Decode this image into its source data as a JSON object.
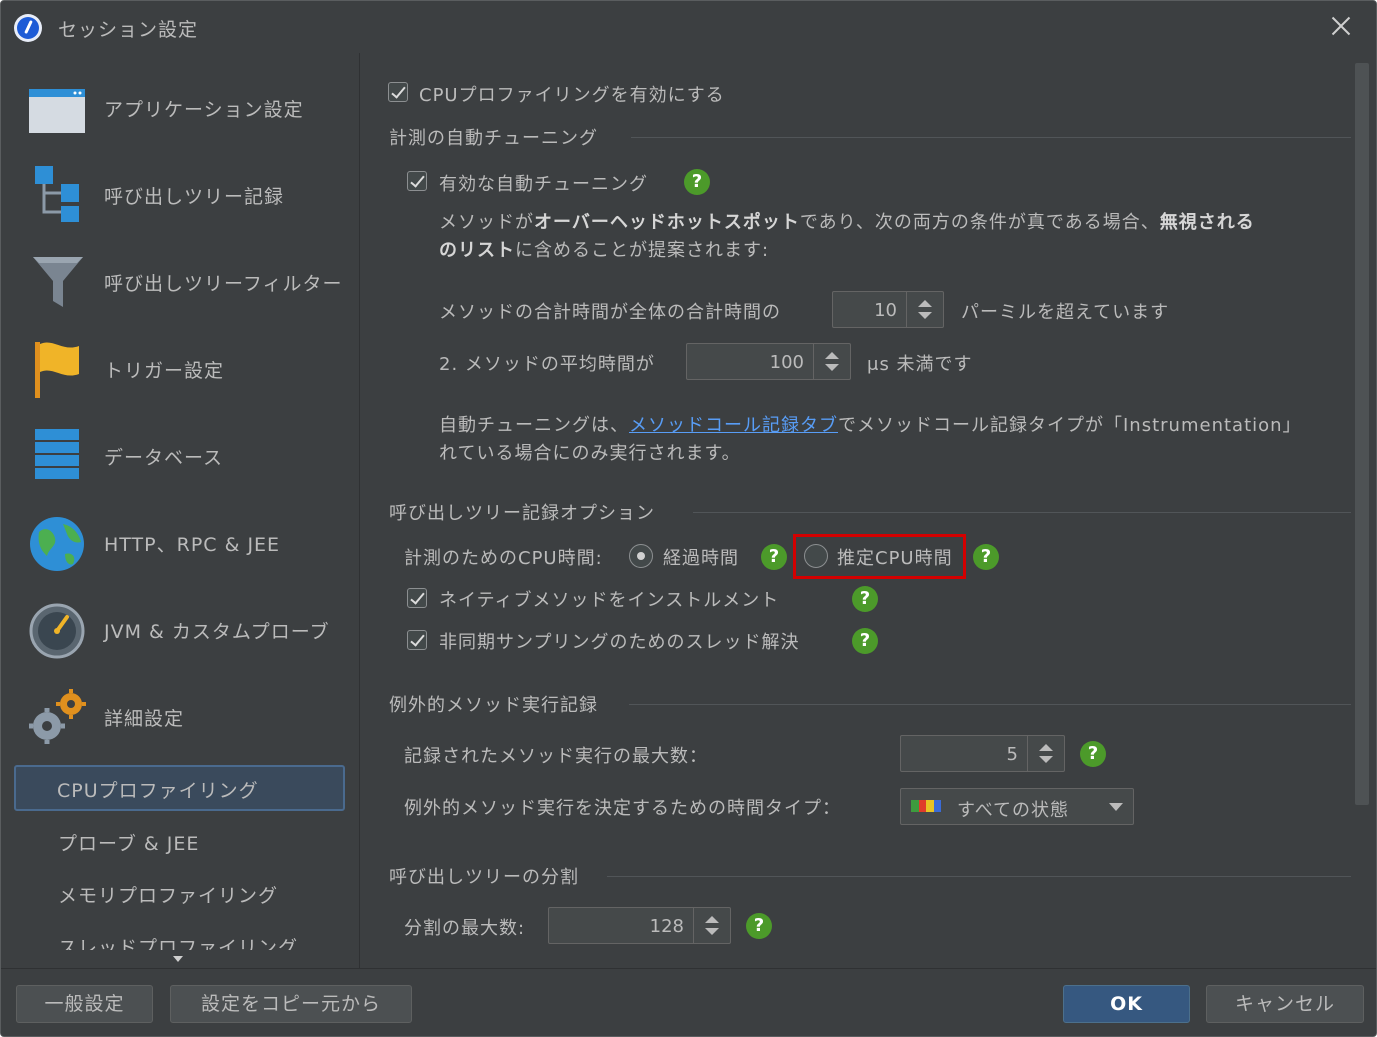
{
  "window": {
    "title": "セッション設定"
  },
  "sidebar": {
    "items": [
      {
        "label": "アプリケーション設定",
        "icon": "application-window-icon"
      },
      {
        "label": "呼び出しツリー記録",
        "icon": "call-tree-icon"
      },
      {
        "label": "呼び出しツリーフィルター",
        "icon": "filter-funnel-icon"
      },
      {
        "label": "トリガー設定",
        "icon": "flag-icon"
      },
      {
        "label": "データベース",
        "icon": "database-icon"
      },
      {
        "label": "HTTP、RPC & JEE",
        "icon": "globe-icon"
      },
      {
        "label": "JVM & カスタムプローブ",
        "icon": "gauge-icon"
      },
      {
        "label": "詳細設定",
        "icon": "gears-icon"
      }
    ],
    "sub_items": [
      {
        "label": "CPUプロファイリング",
        "selected": true
      },
      {
        "label": "プローブ & JEE"
      },
      {
        "label": "メモリプロファイリング"
      },
      {
        "label": "スレッドプロファイリング"
      }
    ]
  },
  "content": {
    "enable_cpu": "CPUプロファイリングを有効にする",
    "auto_tuning": {
      "section_title": "計測の自動チューニング",
      "enabled_label": "有効な自動チューニング",
      "desc_1": "メソッドが",
      "desc_bold_1": "オーバーヘッドホットスポット",
      "desc_2": "であり、次の両方の条件が真である場合、",
      "desc_bold_2": "無視される",
      "desc_bold_3": "のリスト",
      "desc_3": "に含めることが提案されます:",
      "cond1_prefix": "メソッドの合計時間が全体の合計時間の",
      "cond1_value": "10",
      "cond1_suffix": "パーミルを超えています",
      "cond2_prefix": "2. メソッドの平均時間が",
      "cond2_value": "100",
      "cond2_suffix": "μs 未満です",
      "note_1": "自動チューニングは、",
      "note_link": "メソッドコール記録タブ",
      "note_2": "でメソッドコール記録タイプが「Instrumentation」",
      "note_3": "れている場合にのみ実行されます。"
    },
    "call_tree_options": {
      "section_title": "呼び出しツリー記録オプション",
      "cpu_time_label": "計測のためのCPU時間:",
      "radio_elapsed": "経過時間",
      "radio_estimated": "推定CPU時間",
      "native_methods": "ネイティブメソッドをインストルメント",
      "async_sampling": "非同期サンプリングのためのスレッド解決"
    },
    "exceptional": {
      "section_title": "例外的メソッド実行記録",
      "max_label": "記録されたメソッド実行の最大数：",
      "max_value": "5",
      "time_type_label": "例外的メソッド実行を決定するための時間タイプ：",
      "time_type_value": "すべての状態"
    },
    "split": {
      "section_title": "呼び出しツリーの分割",
      "max_label": "分割の最大数:",
      "max_value": "128"
    },
    "help_glyph": "?"
  },
  "footer": {
    "general_settings": "一般設定",
    "copy_settings": "設定をコピー元から",
    "ok": "OK",
    "cancel": "キャンセル"
  },
  "colors": {
    "background": "#3c3f41",
    "help_green": "#4c9a2a",
    "link": "#589df6",
    "highlight": "#d40000",
    "primary_button": "#365880"
  }
}
